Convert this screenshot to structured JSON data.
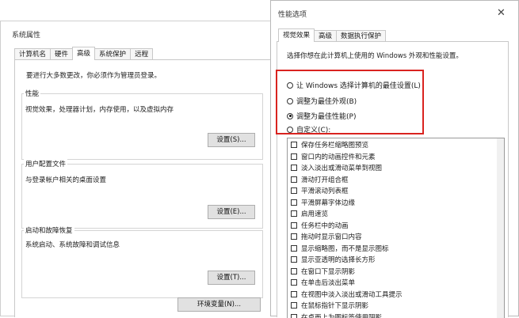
{
  "left_window": {
    "title": "系统属性",
    "tabs": [
      "计算机名",
      "硬件",
      "高级",
      "系统保护",
      "远程"
    ],
    "active_tab": 2,
    "admin_note": "要进行大多数更改，你必须作为管理员登录。",
    "groups": {
      "performance": {
        "label": "性能",
        "desc": "视觉效果，处理器计划，内存使用，以及虚拟内存",
        "button": "设置(S)..."
      },
      "user_profile": {
        "label": "用户配置文件",
        "desc": "与登录帐户相关的桌面设置",
        "button": "设置(E)..."
      },
      "startup": {
        "label": "启动和故障恢复",
        "desc": "系统启动、系统故障和调试信息",
        "button": "设置(T)..."
      }
    },
    "env_button": "环境变量(N)..."
  },
  "right_window": {
    "title": "性能选项",
    "close_glyph": "✕",
    "tabs": [
      "视觉效果",
      "高级",
      "数据执行保护"
    ],
    "active_tab": 0,
    "intro": "选择你想在此计算机上使用的 Windows 外观和性能设置。",
    "radios": [
      {
        "label": "让 Windows 选择计算机的最佳设置(L)",
        "checked": false
      },
      {
        "label": "调整为最佳外观(B)",
        "checked": false
      },
      {
        "label": "调整为最佳性能(P)",
        "checked": true
      },
      {
        "label": "自定义(C):",
        "checked": false
      }
    ],
    "options": [
      "保存任务栏缩略图预览",
      "窗口内的动画控件和元素",
      "淡入淡出或滑动菜单到视图",
      "滑动打开组合框",
      "平滑滚动列表框",
      "平滑屏幕字体边缘",
      "启用速览",
      "任务栏中的动画",
      "拖动时显示窗口内容",
      "显示缩略图，而不是显示图标",
      "显示亚透明的选择长方形",
      "在窗口下显示阴影",
      "在单击后淡出菜单",
      "在视图中淡入淡出或滑动工具提示",
      "在鼠标指针下显示阴影",
      "在桌面上为图标签使用阴影"
    ],
    "highlight_color": "#d9231f"
  }
}
